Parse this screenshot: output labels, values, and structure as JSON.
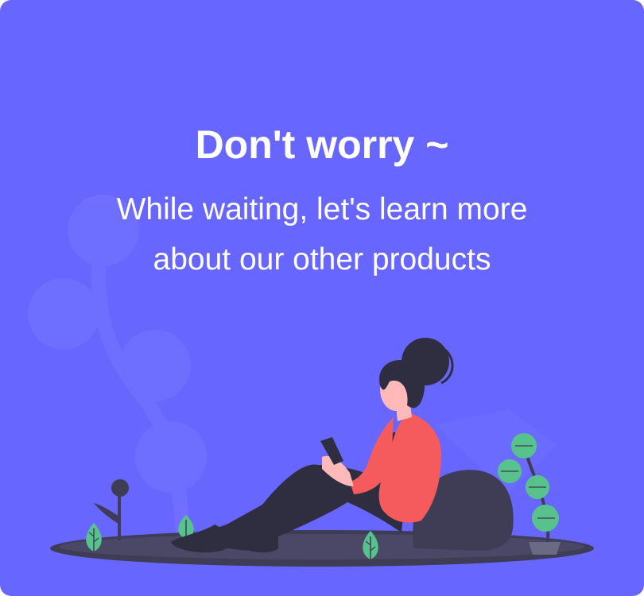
{
  "colors": {
    "background": "#6766ff",
    "text": "#ffffff",
    "ground": "#3f3d56",
    "jacket": "#f55b5d",
    "skin": "#ffb9b9",
    "hair": "#2f2e41",
    "leaf": "#57c28b",
    "decor": "#7a7aff"
  },
  "card": {
    "title": "Don't worry ~",
    "subtitle_line1": "While waiting, let's learn more",
    "subtitle_line2": "about our other products"
  },
  "illustration": {
    "icon": "woman-with-phone-illustration"
  }
}
